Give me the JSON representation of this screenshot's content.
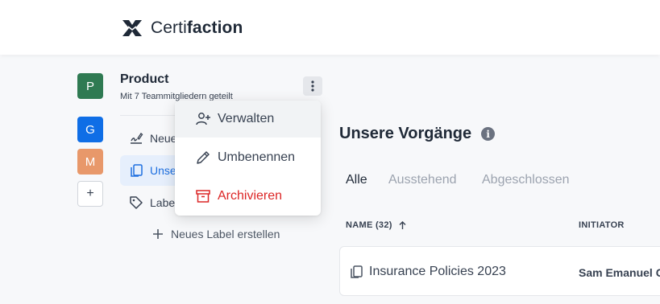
{
  "brand": {
    "name_light": "Certi",
    "name_bold": "faction"
  },
  "workspaces": [
    {
      "initial": "P",
      "color": "#2f7a52"
    },
    {
      "initial": "G",
      "color": "#0f6ee6"
    },
    {
      "initial": "M",
      "color": "#e8986a"
    }
  ],
  "add_workspace_label": "+",
  "workspace": {
    "title": "Product",
    "subtitle": "Mit 7 Teammitgliedern geteilt"
  },
  "sidebar": {
    "items": [
      {
        "label": "Neue",
        "icon": "signature-icon"
      },
      {
        "label": "Unse",
        "icon": "documents-icon",
        "active": true
      },
      {
        "label": "Label",
        "icon": "tag-icon"
      }
    ],
    "new_label": "Neues Label erstellen"
  },
  "context_menu": {
    "items": [
      {
        "label": "Verwalten",
        "icon": "user-plus-icon"
      },
      {
        "label": "Umbenennen",
        "icon": "pencil-icon"
      },
      {
        "label": "Archivieren",
        "icon": "archive-icon",
        "color": "#dc2626"
      }
    ]
  },
  "main": {
    "title": "Unsere Vorgänge",
    "tabs": [
      {
        "label": "Alle",
        "active": true
      },
      {
        "label": "Ausstehend"
      },
      {
        "label": "Abgeschlossen"
      }
    ],
    "table": {
      "columns": {
        "name": "NAME (32)",
        "initiator": "INITIATOR"
      },
      "rows": [
        {
          "name": "Insurance Policies 2023",
          "initiator": "Sam Emanuel C"
        }
      ]
    }
  },
  "colors": {
    "accent": "#1d6fe0",
    "danger": "#dc2626"
  }
}
